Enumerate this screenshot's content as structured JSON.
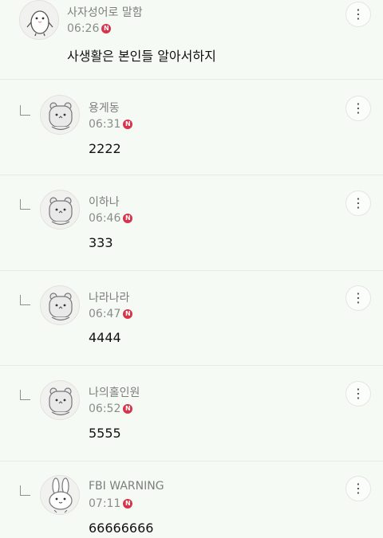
{
  "comments": [
    {
      "author": "사자성어로 말함",
      "time": "06:26",
      "new_badge": "N",
      "text": "사생활은 본인들 알아서하지",
      "avatar_icon": "penguin-avatar-icon"
    },
    {
      "author": "용게동",
      "time": "06:31",
      "new_badge": "N",
      "text": "2222",
      "avatar_icon": "hamster-avatar-icon"
    },
    {
      "author": "이하나",
      "time": "06:46",
      "new_badge": "N",
      "text": "333",
      "avatar_icon": "hamster-avatar-icon"
    },
    {
      "author": "나라나라",
      "time": "06:47",
      "new_badge": "N",
      "text": "4444",
      "avatar_icon": "hamster-avatar-icon"
    },
    {
      "author": "나의홀인원",
      "time": "06:52",
      "new_badge": "N",
      "text": "5555",
      "avatar_icon": "hamster-avatar-icon"
    },
    {
      "author": "FBI WARNING",
      "time": "07:11",
      "new_badge": "N",
      "text": "66666666",
      "avatar_icon": "rabbit-avatar-icon"
    }
  ],
  "more_glyph": "⋮",
  "colors": {
    "background": "#f5faf4",
    "badge": "#d8334a",
    "divider": "#e6ebe5"
  }
}
